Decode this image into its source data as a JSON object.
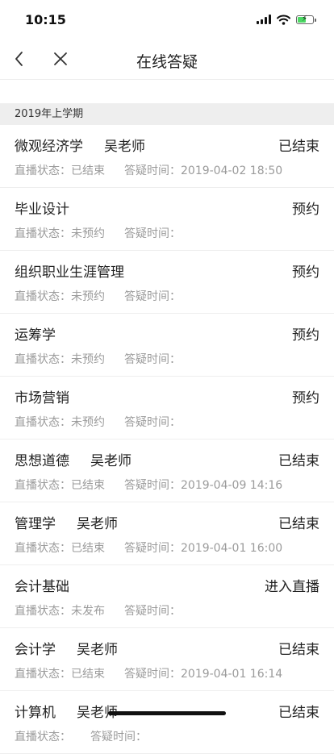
{
  "status_bar": {
    "time": "10:15",
    "battery_level": 0.5
  },
  "nav": {
    "title": "在线答疑",
    "back_icon": "chevron-left-icon",
    "close_icon": "close-icon"
  },
  "section": {
    "label": "2019年上学期"
  },
  "meta_labels": {
    "status": "直播状态：",
    "time": "答疑时间："
  },
  "courses": [
    {
      "name": "微观经济学",
      "teacher": "吴老师",
      "action": "已结束",
      "status": "已结束",
      "time": "2019-04-02 18:50"
    },
    {
      "name": "毕业设计",
      "teacher": "",
      "action": "预约",
      "status": "未预约",
      "time": ""
    },
    {
      "name": "组织职业生涯管理",
      "teacher": "",
      "action": "预约",
      "status": "未预约",
      "time": ""
    },
    {
      "name": "运筹学",
      "teacher": "",
      "action": "预约",
      "status": "未预约",
      "time": ""
    },
    {
      "name": "市场营销",
      "teacher": "",
      "action": "预约",
      "status": "未预约",
      "time": ""
    },
    {
      "name": "思想道德",
      "teacher": "吴老师",
      "action": "已结束",
      "status": "已结束",
      "time": "2019-04-09 14:16"
    },
    {
      "name": "管理学",
      "teacher": "吴老师",
      "action": "已结束",
      "status": "已结束",
      "time": "2019-04-01 16:00"
    },
    {
      "name": "会计基础",
      "teacher": "",
      "action": "进入直播",
      "status": "未发布",
      "time": ""
    },
    {
      "name": "会计学",
      "teacher": "吴老师",
      "action": "已结束",
      "status": "已结束",
      "time": "2019-04-01 16:14"
    },
    {
      "name": "计算机",
      "teacher": "吴老师",
      "action": "已结束",
      "status": "",
      "time": ""
    }
  ]
}
